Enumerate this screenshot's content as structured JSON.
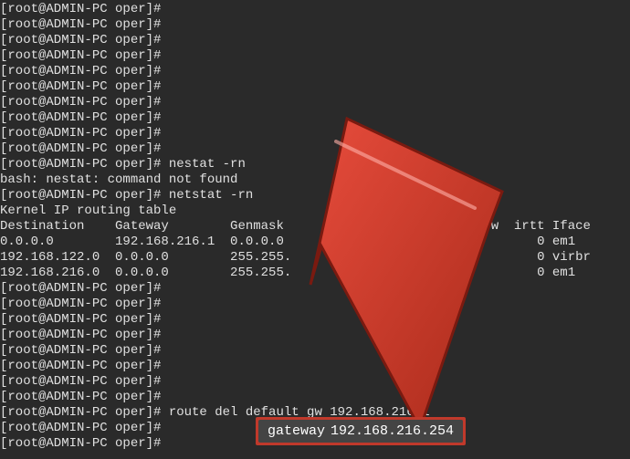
{
  "prompt": "[root@ADMIN-PC oper]# ",
  "lines_before": [
    "[root@ADMIN-PC oper]# ",
    "[root@ADMIN-PC oper]# ",
    "[root@ADMIN-PC oper]# ",
    "[root@ADMIN-PC oper]# ",
    "[root@ADMIN-PC oper]# ",
    "[root@ADMIN-PC oper]# ",
    "[root@ADMIN-PC oper]# ",
    "[root@ADMIN-PC oper]# ",
    "[root@ADMIN-PC oper]# ",
    "[root@ADMIN-PC oper]# ",
    "[root@ADMIN-PC oper]# nestat -rn",
    "bash: nestat: command not found",
    "[root@ADMIN-PC oper]# netstat -rn",
    "Kernel IP routing table"
  ],
  "table": {
    "header": "Destination    Gateway        Genmask                  MSS Window  irtt Iface",
    "rows": [
      "0.0.0.0        192.168.216.1  0.0.0.0                    0 0          0 em1",
      "192.168.122.0  0.0.0.0        255.255.                     0          0 virbr",
      "192.168.216.0  0.0.0.0        255.255.                                0 em1"
    ]
  },
  "lines_after": [
    "[root@ADMIN-PC oper]# ",
    "[root@ADMIN-PC oper]# ",
    "[root@ADMIN-PC oper]# ",
    "[root@ADMIN-PC oper]# ",
    "[root@ADMIN-PC oper]# ",
    "[root@ADMIN-PC oper]# ",
    "[root@ADMIN-PC oper]# ",
    "[root@ADMIN-PC oper]# ",
    "[root@ADMIN-PC oper]# route del default gw 192.168.216.1",
    "[root@ADMIN-PC oper]# ",
    "[root@ADMIN-PC oper]# "
  ],
  "callout": {
    "label": "gateway",
    "value": "192.168.216.254"
  }
}
